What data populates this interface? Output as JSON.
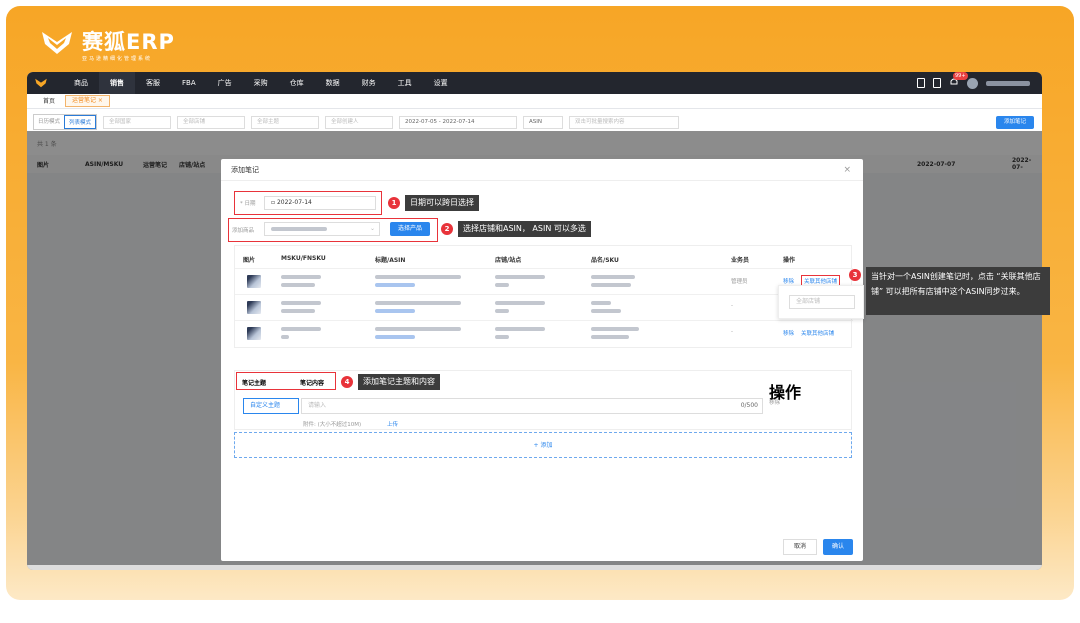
{
  "brand": {
    "name": "赛狐ERP",
    "tagline": "亚马逊精细化管理系统"
  },
  "nav": {
    "items": [
      "商品",
      "销售",
      "客服",
      "FBA",
      "广告",
      "采购",
      "仓库",
      "数据",
      "财务",
      "工具",
      "设置"
    ],
    "active_index": 1,
    "badge": "99+"
  },
  "tabs": [
    "首页",
    "运营笔记 ×"
  ],
  "filters": {
    "modes": [
      "日历模式",
      "列表模式"
    ],
    "selects": [
      "全部国家",
      "全部店铺",
      "全部主题",
      "全部创建人"
    ],
    "date_range": "2022-07-05  -  2022-07-14",
    "search_type": "ASIN",
    "search_placeholder": "双击可批量搜索内容",
    "add_button": "添加笔记"
  },
  "list": {
    "total": "共 1 条",
    "headers": [
      "图片",
      "ASIN/MSKU",
      "运营笔记",
      "店铺/站点"
    ],
    "date_cols": [
      "2022-07-07",
      "2022-07-"
    ]
  },
  "modal": {
    "title": "添加笔记",
    "date_label": "* 日期",
    "date_value": "2022-07-14",
    "add_product_label": "添加商品",
    "select_product_button": "选择产品",
    "product_headers": [
      "图片",
      "MSKU/FNSKU",
      "标题/ASIN",
      "店铺/站点",
      "品名/SKU",
      "业务员",
      "操作"
    ],
    "rows": [
      {
        "salesman": "管理员",
        "actions": [
          "移除",
          "关联其他店铺"
        ]
      },
      {
        "salesman": "-",
        "actions": []
      },
      {
        "salesman": "-",
        "actions": [
          "移除",
          "关联其他店铺"
        ]
      }
    ],
    "popover_select": "全部店铺",
    "note_headers": [
      "笔记主题",
      "笔记内容",
      "操作"
    ],
    "custom_topic": "自定义主题",
    "content_placeholder": "请输入",
    "counter": "0/500",
    "remove": "移除",
    "attachment_label": "附件: (大小不超过10M)",
    "upload": "上传",
    "add_row": "+ 添加",
    "cancel": "取消",
    "confirm": "确认"
  },
  "callouts": [
    {
      "n": "1",
      "text": "日期可以跨日选择"
    },
    {
      "n": "2",
      "text": "选择店铺和ASIN， ASIN 可以多选"
    },
    {
      "n": "3",
      "text": "当针对一个ASIN创建笔记时，点击 “关联其他店铺” 可以把所有店铺中这个ASIN同步过来。"
    },
    {
      "n": "4",
      "text": "添加笔记主题和内容"
    }
  ]
}
